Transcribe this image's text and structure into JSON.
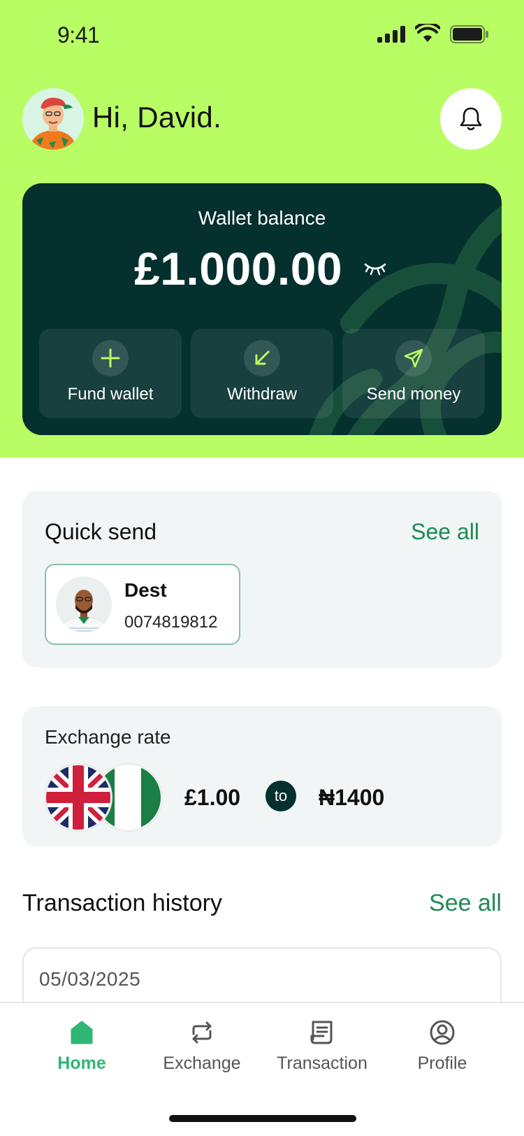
{
  "status_bar": {
    "time": "9:41"
  },
  "header": {
    "greeting": "Hi, David."
  },
  "wallet": {
    "label": "Wallet balance",
    "amount": "£1.000.00",
    "actions": [
      {
        "label": "Fund wallet",
        "icon": "plus-icon"
      },
      {
        "label": "Withdraw",
        "icon": "arrow-down-left-icon"
      },
      {
        "label": "Send money",
        "icon": "send-icon"
      }
    ]
  },
  "quick_send": {
    "title": "Quick send",
    "see_all": "See all",
    "recipients": [
      {
        "name": "Dest",
        "account": "0074819812"
      }
    ]
  },
  "exchange_rate": {
    "title": "Exchange rate",
    "from": "£1.00",
    "connector": "to",
    "to": "₦1400"
  },
  "transactions": {
    "title": "Transaction history",
    "see_all": "See all",
    "items": [
      {
        "date": "05/03/2025"
      }
    ]
  },
  "tabs": [
    {
      "label": "Home",
      "icon": "home-icon",
      "active": true
    },
    {
      "label": "Exchange",
      "icon": "exchange-icon",
      "active": false
    },
    {
      "label": "Transaction",
      "icon": "receipt-icon",
      "active": false
    },
    {
      "label": "Profile",
      "icon": "profile-icon",
      "active": false
    }
  ],
  "colors": {
    "brand_lime": "#b8fd63",
    "dark_teal": "#04302e",
    "accent_green": "#2fb673"
  }
}
